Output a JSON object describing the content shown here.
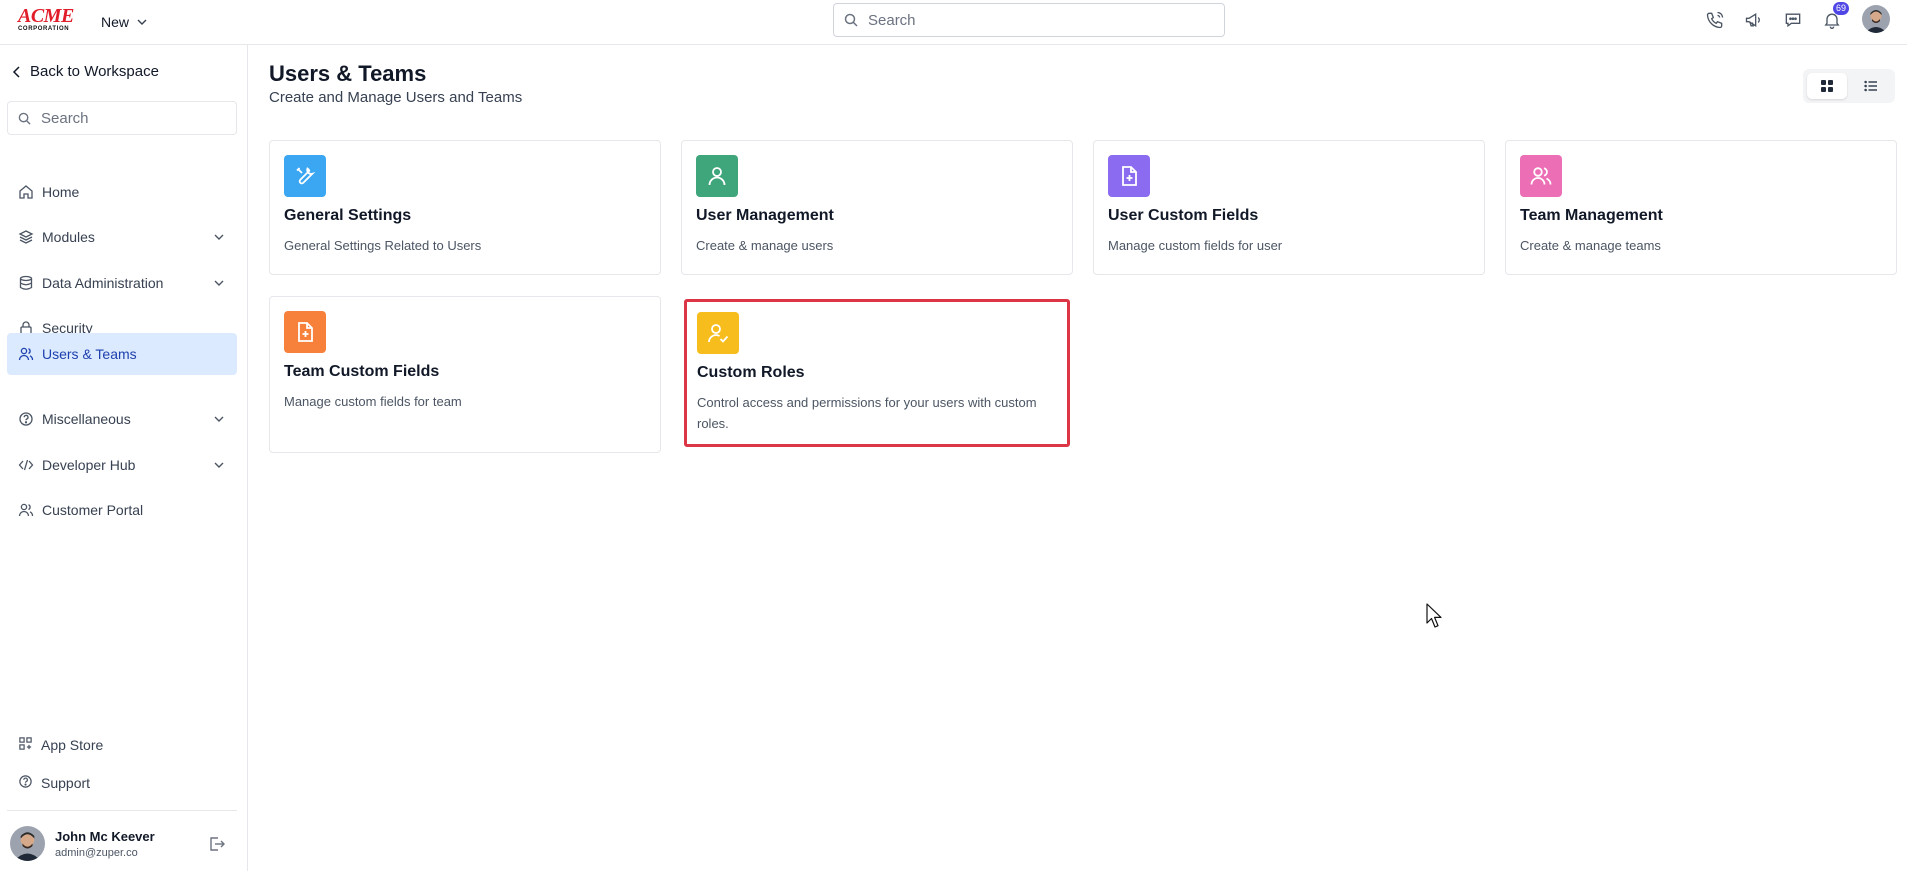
{
  "topbar": {
    "logo_line1": "ACME",
    "logo_line2": "CORPORATION",
    "new_label": "New",
    "search_placeholder": "Search",
    "notification_count": "69"
  },
  "sidebar": {
    "back_label": "Back to Workspace",
    "search_placeholder": "Search",
    "items": [
      {
        "label": "Home",
        "icon": "home-icon",
        "expandable": false
      },
      {
        "label": "Modules",
        "icon": "layers-icon",
        "expandable": true
      },
      {
        "label": "Data Administration",
        "icon": "database-icon",
        "expandable": true
      },
      {
        "label": "Security",
        "icon": "lock-icon",
        "expandable": false
      },
      {
        "label": "Users & Teams",
        "icon": "users-icon",
        "expandable": false,
        "active": true
      },
      {
        "label": "Miscellaneous",
        "icon": "help-circle-icon",
        "expandable": true
      },
      {
        "label": "Developer Hub",
        "icon": "code-icon",
        "expandable": true
      },
      {
        "label": "Customer Portal",
        "icon": "users-icon",
        "expandable": false
      }
    ],
    "bottom_items": [
      {
        "label": "App Store",
        "icon": "apps-icon"
      },
      {
        "label": "Support",
        "icon": "help-circle-icon"
      }
    ],
    "profile": {
      "name": "John Mc Keever",
      "email": "admin@zuper.co"
    }
  },
  "main": {
    "title": "Users & Teams",
    "subtitle": "Create and Manage Users and Teams",
    "cards": [
      {
        "title": "General Settings",
        "description": "General Settings Related to Users",
        "icon": "wrench-icon",
        "color": "#3ba6f2"
      },
      {
        "title": "User Management",
        "description": "Create & manage users",
        "icon": "user-icon",
        "color": "#3fa57a"
      },
      {
        "title": "User Custom Fields",
        "description": "Manage custom fields for user",
        "icon": "file-plus-icon",
        "color": "#8b6cf0"
      },
      {
        "title": "Team Management",
        "description": "Create & manage teams",
        "icon": "users-icon",
        "color": "#ec6fb6"
      },
      {
        "title": "Team Custom Fields",
        "description": "Manage custom fields for team",
        "icon": "file-plus-icon",
        "color": "#f7803b"
      },
      {
        "title": "Custom Roles",
        "description": "Control access and permissions for your users with custom roles.",
        "icon": "user-check-icon",
        "color": "#f7bd1c"
      }
    ]
  },
  "colors": {
    "accent": "#1e40af",
    "active_bg": "#dbeafe",
    "selection_border": "#dc3545",
    "badge": "#4f46e5"
  }
}
